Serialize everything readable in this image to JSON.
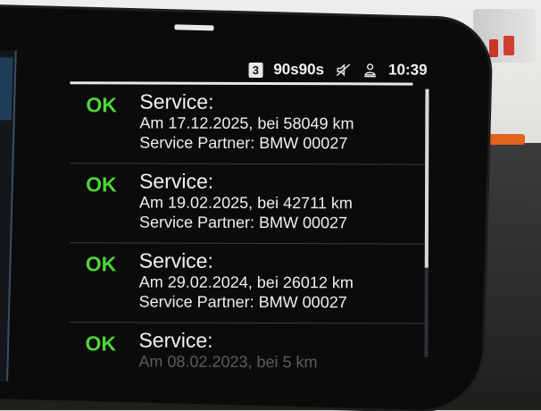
{
  "status_bar": {
    "mode_number": "3",
    "station": "90s90s",
    "mute_icon": "mute-icon",
    "profile_icon": "profile-icon",
    "time": "10:39"
  },
  "entries": [
    {
      "status": "OK",
      "title": "Service:",
      "line1": "Am 17.12.2025, bei 58049 km",
      "line2": "Service Partner: BMW 00027"
    },
    {
      "status": "OK",
      "title": "Service:",
      "line1": "Am 19.02.2025, bei 42711 km",
      "line2": "Service Partner: BMW 00027"
    },
    {
      "status": "OK",
      "title": "Service:",
      "line1": "Am 29.02.2024, bei 26012 km",
      "line2": "Service Partner: BMW 00027"
    },
    {
      "status": "OK",
      "title": "Service:",
      "line1": "Am 08.02.2023, bei 5 km",
      "line2": ""
    }
  ],
  "colors": {
    "ok_green": "#52d43a",
    "screen_bg": "#0b0b0c",
    "text": "#f2f2f2"
  }
}
